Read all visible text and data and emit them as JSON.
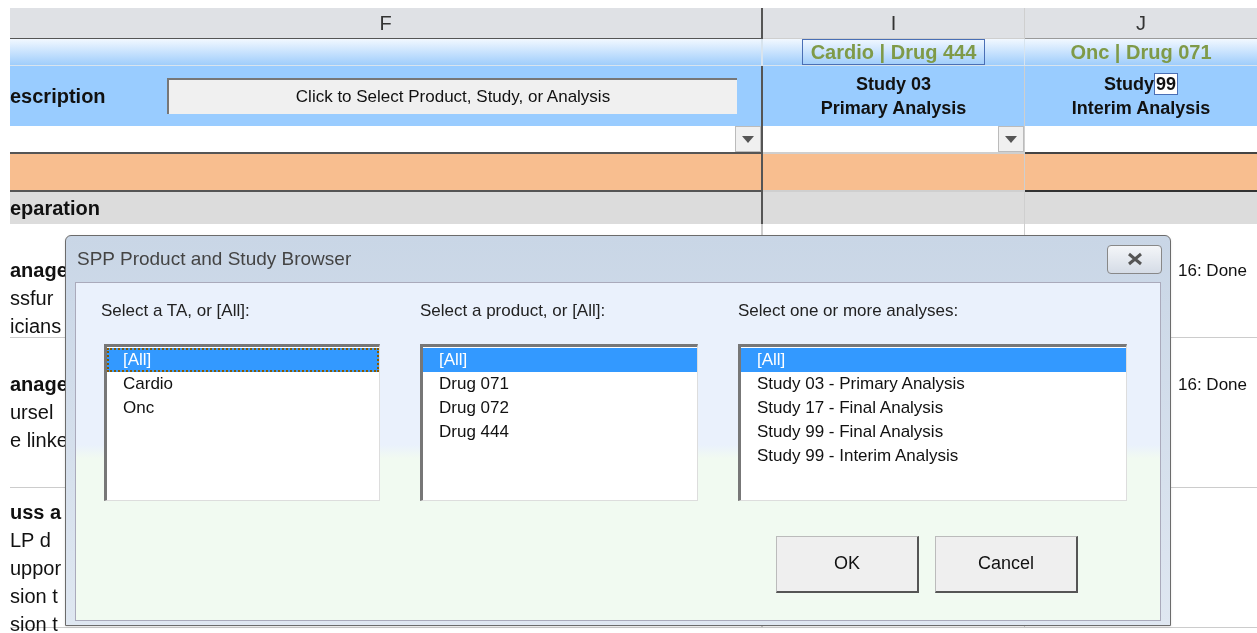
{
  "columns": [
    {
      "letter": "F",
      "boxed": false,
      "dropdown": true
    },
    {
      "letter": "I",
      "label": "Cardio | Drug 444",
      "boxed": true,
      "line1": "Study 03",
      "line2": "Primary Analysis",
      "dropdown": true
    },
    {
      "letter": "J",
      "label": "Onc | Drug 071",
      "boxed": false,
      "line1": "Study",
      "line1_boxed": "99",
      "line2": "Interim Analysis",
      "dropdown": false
    }
  ],
  "description_label": "escription",
  "select_button": "Click to Select Product, Study, or Analysis",
  "section_label": "eparation",
  "rows": [
    {
      "lines": [
        "anage",
        "ssfur",
        "icians"
      ],
      "status": "16: Done"
    },
    {
      "lines": [
        "anage",
        "ursel",
        "e linke"
      ],
      "status": "16: Done"
    },
    {
      "lines": [
        "uss a",
        "LP d",
        "uppor",
        "sion t",
        "sion t"
      ]
    }
  ],
  "dialog": {
    "title": "SPP Product and Study Browser",
    "lists": [
      {
        "label": "Select a TA, or [All]:",
        "focused": true,
        "items": [
          {
            "text": "[All]",
            "selected": true
          },
          {
            "text": "Cardio",
            "selected": false
          },
          {
            "text": "Onc",
            "selected": false
          }
        ]
      },
      {
        "label": "Select a product, or [All]:",
        "focused": false,
        "items": [
          {
            "text": "[All]",
            "selected": true
          },
          {
            "text": "Drug 071",
            "selected": false
          },
          {
            "text": "Drug 072",
            "selected": false
          },
          {
            "text": "Drug 444",
            "selected": false
          }
        ]
      },
      {
        "label": "Select one or more analyses:",
        "focused": false,
        "items": [
          {
            "text": "[All]",
            "selected": true
          },
          {
            "text": "Study 03 - Primary Analysis",
            "selected": false
          },
          {
            "text": "Study 17 - Final Analysis",
            "selected": false
          },
          {
            "text": "Study 99 - Final Analysis",
            "selected": false
          },
          {
            "text": "Study 99 - Interim Analysis",
            "selected": false
          }
        ]
      }
    ],
    "buttons": [
      "OK",
      "Cancel"
    ]
  }
}
